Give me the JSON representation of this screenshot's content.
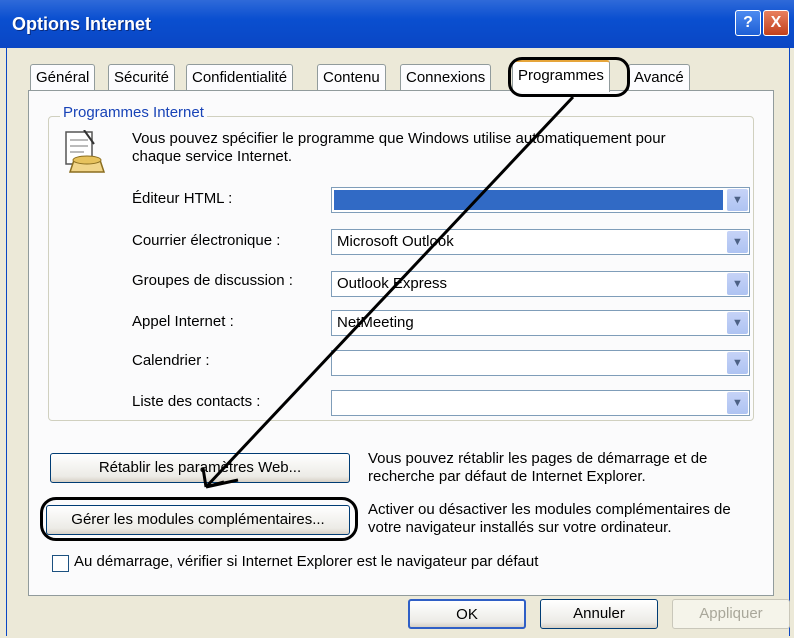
{
  "window": {
    "title": "Options Internet",
    "help_label": "?",
    "close_label": "X"
  },
  "tabs": [
    "Général",
    "Sécurité",
    "Confidentialité",
    "Contenu",
    "Connexions",
    "Programmes",
    "Avancé"
  ],
  "group": {
    "label": "Programmes Internet",
    "icon": "phone-notepad-icon",
    "description": "Vous pouvez spécifier le programme que Windows utilise automatiquement pour chaque service Internet."
  },
  "fields": [
    {
      "label": "Éditeur HTML :",
      "value": ""
    },
    {
      "label": "Courrier électronique :",
      "value": "Microsoft Outlook"
    },
    {
      "label": "Groupes de discussion :",
      "value": "Outlook Express"
    },
    {
      "label": "Appel Internet :",
      "value": "NetMeeting"
    },
    {
      "label": "Calendrier :",
      "value": ""
    },
    {
      "label": "Liste des contacts :",
      "value": ""
    }
  ],
  "reset": {
    "button": "Rétablir les paramètres Web...",
    "text": "Vous pouvez rétablir les pages de démarrage et de recherche par défaut de Internet Explorer."
  },
  "addons": {
    "button": "Gérer les modules complémentaires...",
    "text": "Activer ou désactiver les modules complémentaires de votre navigateur installés sur votre ordinateur."
  },
  "checkbox_label": "Au démarrage, vérifier si Internet Explorer est le navigateur par défaut",
  "footer": {
    "ok": "OK",
    "cancel": "Annuler",
    "apply": "Appliquer"
  },
  "colors": {
    "titlebar": "#0a46c4",
    "selection": "#316ac5",
    "group_label": "#1843b7"
  }
}
